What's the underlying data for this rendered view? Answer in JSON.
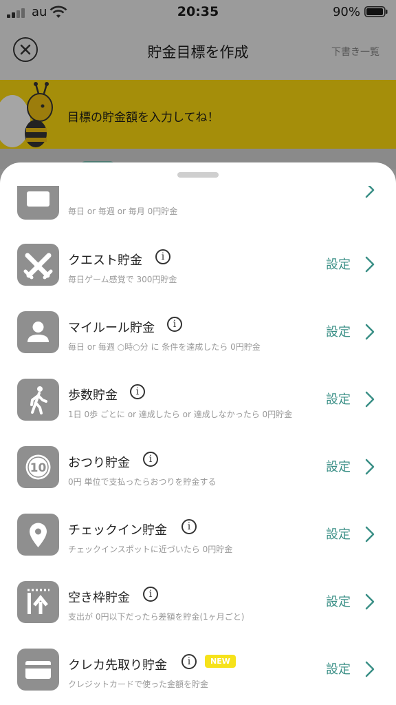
{
  "status_bar": {
    "carrier": "au",
    "time": "20:35",
    "battery": "90%"
  },
  "nav": {
    "title": "貯金目標を作成",
    "draft_link": "下書き一覧"
  },
  "banner": {
    "text": "目標の貯金額を入力してね！"
  },
  "items": [
    {
      "title": "",
      "description": "毎日 or 毎週 or 毎月 0円貯金",
      "icon": "calendar-icon",
      "action": ""
    },
    {
      "title": "クエスト貯金",
      "description": "毎日ゲーム感覚で 300円貯金",
      "icon": "swords-icon",
      "action": "設定"
    },
    {
      "title": "マイルール貯金",
      "description": "毎日 or 毎週 ○時○分 に 条件を達成したら 0円貯金",
      "icon": "person-icon",
      "action": "設定"
    },
    {
      "title": "歩数貯金",
      "description": "1日 0歩 ごとに or 達成したら or 達成しなかったら 0円貯金",
      "icon": "walking-icon",
      "action": "設定"
    },
    {
      "title": "おつり貯金",
      "description": "0円 単位で支払ったらおつりを貯金する",
      "icon": "coin-10-icon",
      "coin_label": "10",
      "action": "設定"
    },
    {
      "title": "チェックイン貯金",
      "description": "チェックインスポットに近づいたら 0円貯金",
      "icon": "location-pin-icon",
      "action": "設定"
    },
    {
      "title": "空き枠貯金",
      "description": "支出が 0円以下だったら差額を貯金(1ヶ月ごと)",
      "icon": "upload-arrow-icon",
      "action": "設定"
    },
    {
      "title": "クレカ先取り貯金",
      "description": "クレジットカードで使った金額を貯金",
      "icon": "credit-card-icon",
      "badge": "NEW",
      "action": "設定"
    }
  ],
  "colors": {
    "accent": "#3a8f86",
    "badge": "#f6e21a",
    "icon_bg": "#8f8f8f"
  }
}
